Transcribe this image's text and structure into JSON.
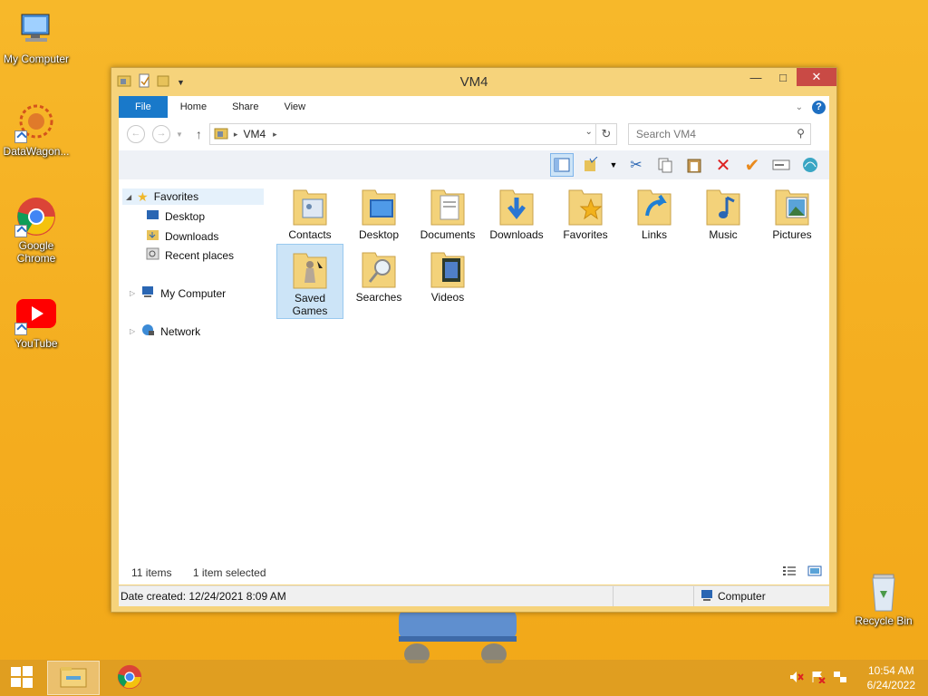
{
  "desktop": {
    "icons": [
      {
        "label": "My Computer"
      },
      {
        "label": "DataWagon..."
      },
      {
        "label": "Google Chrome"
      },
      {
        "label": "YouTube"
      },
      {
        "label": "Recycle Bin"
      }
    ]
  },
  "window": {
    "title": "VM4",
    "tabs": [
      "File",
      "Home",
      "Share",
      "View"
    ],
    "address": {
      "crumb": "VM4"
    },
    "search": {
      "placeholder": "Search VM4"
    },
    "nav": {
      "favorites": "Favorites",
      "desktop": "Desktop",
      "downloads": "Downloads",
      "recent": "Recent places",
      "computer": "My Computer",
      "network": "Network"
    },
    "items": [
      {
        "label": "Contacts",
        "icon": "contacts-icon"
      },
      {
        "label": "Desktop",
        "icon": "desktop-icon"
      },
      {
        "label": "Documents",
        "icon": "documents-icon"
      },
      {
        "label": "Downloads",
        "icon": "downloads-icon"
      },
      {
        "label": "Favorites",
        "icon": "favorites-icon"
      },
      {
        "label": "Links",
        "icon": "links-icon"
      },
      {
        "label": "Music",
        "icon": "music-icon"
      },
      {
        "label": "Pictures",
        "icon": "pictures-icon"
      },
      {
        "label": "Saved Games",
        "icon": "saved-games-icon"
      },
      {
        "label": "Searches",
        "icon": "searches-icon"
      },
      {
        "label": "Videos",
        "icon": "videos-icon"
      }
    ],
    "status": {
      "count": "11 items",
      "selected": "1 item selected"
    },
    "details": {
      "created": "Date created: 12/24/2021 8:09 AM",
      "location": "Computer"
    }
  },
  "taskbar": {
    "time": "10:54 AM",
    "date": "6/24/2022"
  },
  "colors": {
    "accent": "#1979ca",
    "desktop": "#f4ad1f",
    "folder": "#f3d27a"
  }
}
